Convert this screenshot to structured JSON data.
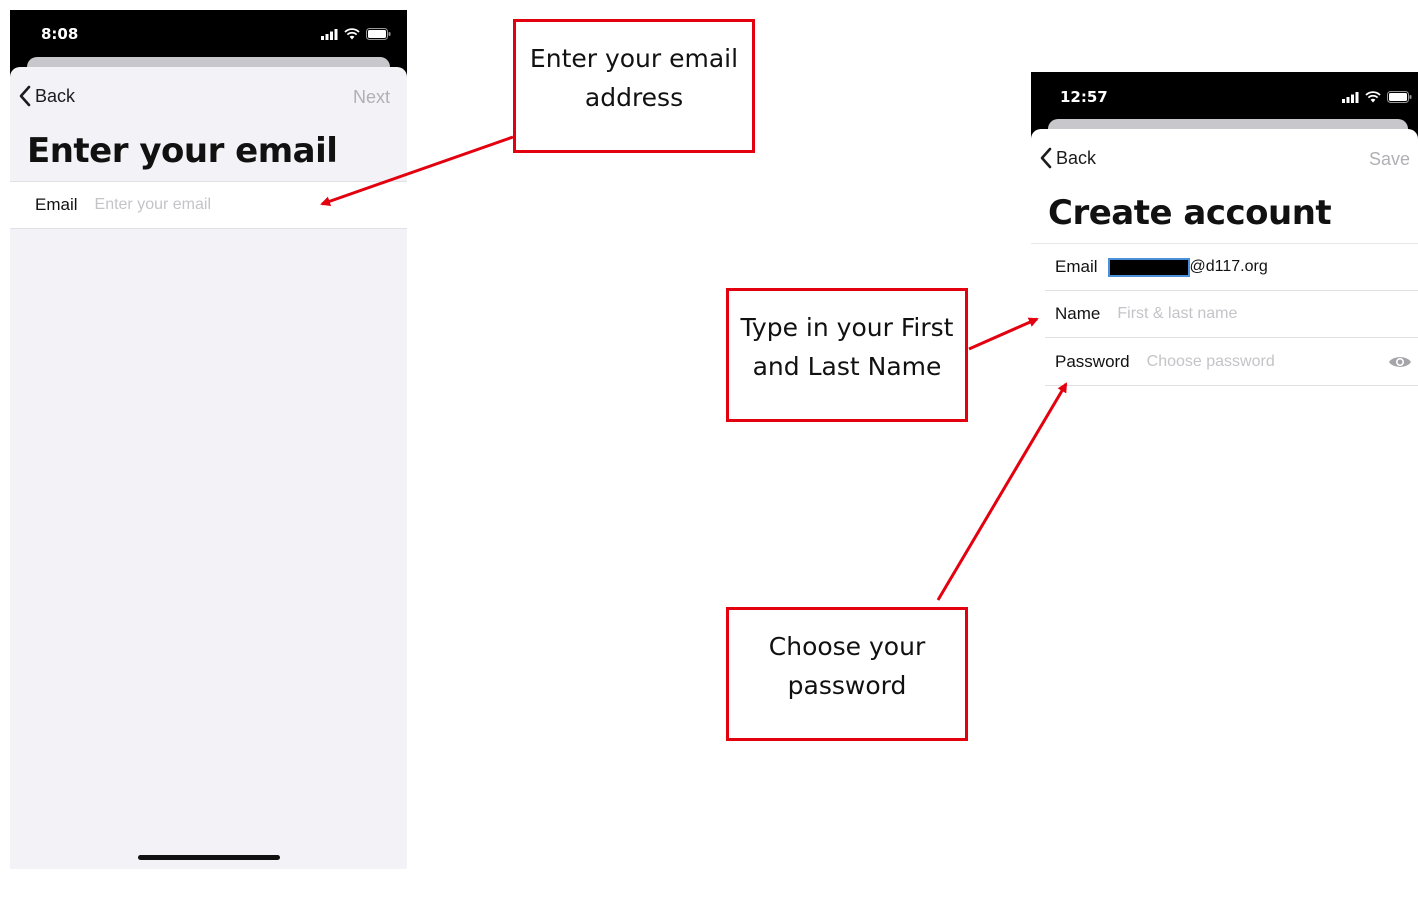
{
  "screen1": {
    "time": "8:08",
    "back_label": "Back",
    "right_action": "Next",
    "title": "Enter your email",
    "email_label": "Email",
    "email_placeholder": "Enter your email"
  },
  "screen2": {
    "time": "12:57",
    "back_label": "Back",
    "right_action": "Save",
    "title": "Create account",
    "email_label": "Email",
    "email_value_suffix": "@d117.org",
    "name_label": "Name",
    "name_placeholder": "First & last name",
    "password_label": "Password",
    "password_placeholder": "Choose password"
  },
  "callouts": {
    "email_line1": "Enter your email",
    "email_line2": "address",
    "name_line1": "Type in your First",
    "name_line2": "and Last Name",
    "password_line1": "Choose your",
    "password_line2": "password"
  },
  "colors": {
    "annotation_red": "#e3000f",
    "sheet_bg": "#f2f2f7",
    "redaction": "#000000",
    "redaction_border": "#4a90d9"
  },
  "icons": [
    "chevron-left-icon",
    "signal-icon",
    "wifi-icon",
    "battery-icon",
    "eye-icon"
  ]
}
